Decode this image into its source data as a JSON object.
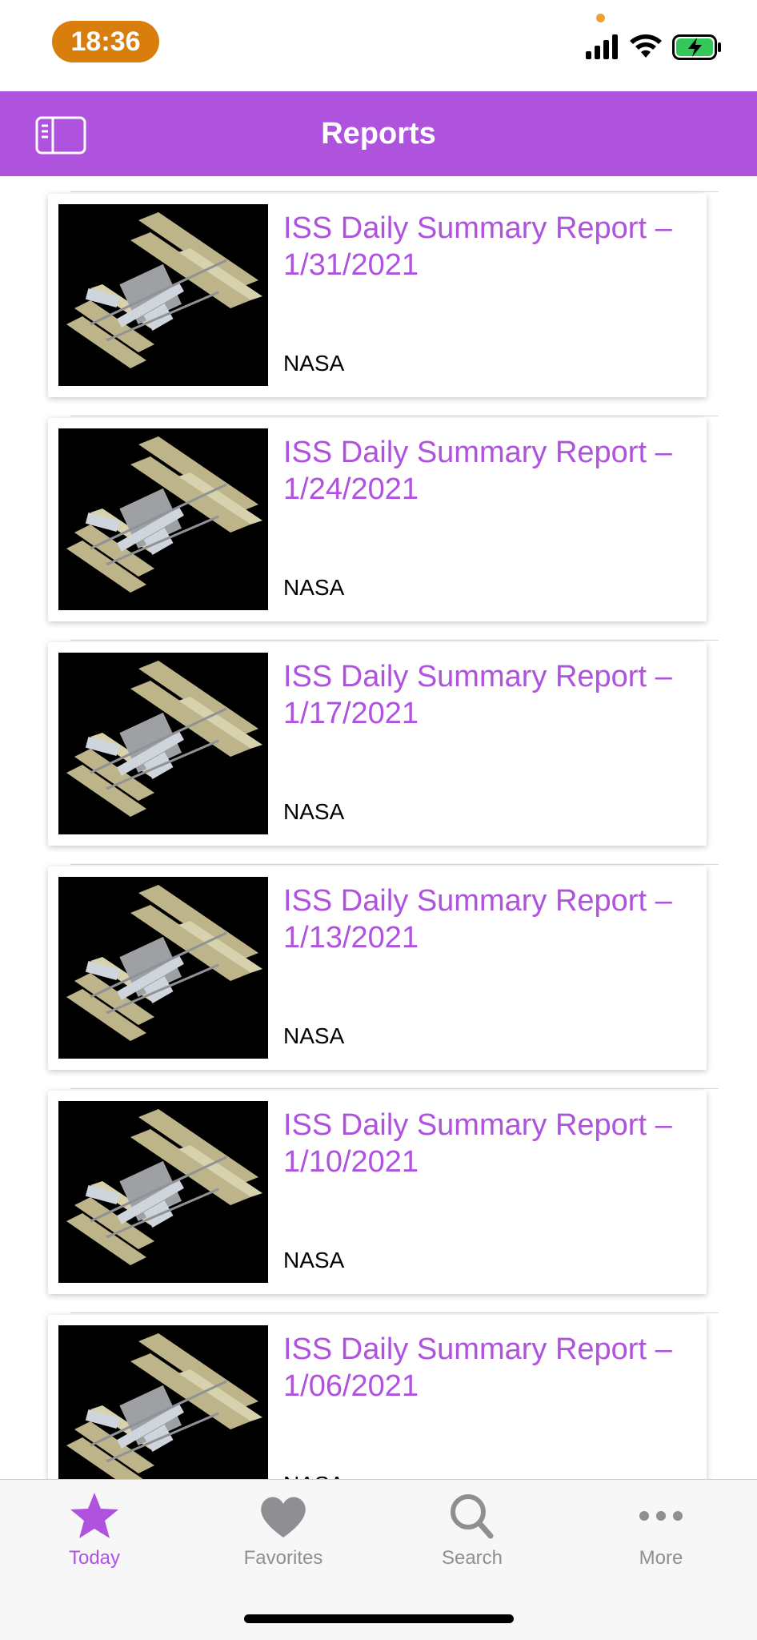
{
  "status_bar": {
    "time": "18:36",
    "accent_color": "#d97d0d"
  },
  "nav": {
    "title": "Reports",
    "sidebar_icon": "sidebar-icon",
    "color": "#af52de"
  },
  "reports": [
    {
      "title": "ISS Daily Summary Report – 1/31/2021",
      "source": "NASA"
    },
    {
      "title": "ISS Daily Summary Report – 1/24/2021",
      "source": "NASA"
    },
    {
      "title": "ISS Daily Summary Report – 1/17/2021",
      "source": "NASA"
    },
    {
      "title": "ISS Daily Summary Report – 1/13/2021",
      "source": "NASA"
    },
    {
      "title": "ISS Daily Summary Report – 1/10/2021",
      "source": "NASA"
    },
    {
      "title": "ISS Daily Summary Report – 1/06/2021",
      "source": "NASA"
    }
  ],
  "tabs": [
    {
      "label": "Today",
      "icon": "star-icon",
      "active": true
    },
    {
      "label": "Favorites",
      "icon": "heart-icon",
      "active": false
    },
    {
      "label": "Search",
      "icon": "search-icon",
      "active": false
    },
    {
      "label": "More",
      "icon": "more-icon",
      "active": false
    }
  ]
}
